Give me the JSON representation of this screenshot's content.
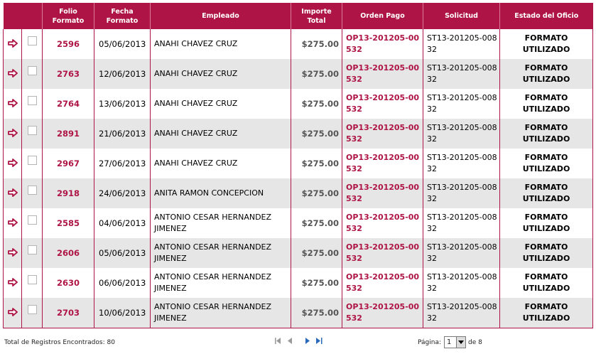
{
  "headers": {
    "folio": "Folio Formato",
    "fecha": "Fecha Formato",
    "empleado": "Empleado",
    "importe": "Importe Total",
    "orden": "Orden Pago",
    "solicitud": "Solicitud",
    "estado": "Estado del Oficio"
  },
  "rows": [
    {
      "folio": "2596",
      "fecha": "05/06/2013",
      "empleado": "ANAHI CHAVEZ CRUZ",
      "importe": "$275.00",
      "orden": "OP13-201205-00532",
      "solicitud": "ST13-201205-00832",
      "estado": "FORMATO UTILIZADO"
    },
    {
      "folio": "2763",
      "fecha": "12/06/2013",
      "empleado": "ANAHI CHAVEZ CRUZ",
      "importe": "$275.00",
      "orden": "OP13-201205-00532",
      "solicitud": "ST13-201205-00832",
      "estado": "FORMATO UTILIZADO"
    },
    {
      "folio": "2764",
      "fecha": "13/06/2013",
      "empleado": "ANAHI CHAVEZ CRUZ",
      "importe": "$275.00",
      "orden": "OP13-201205-00532",
      "solicitud": "ST13-201205-00832",
      "estado": "FORMATO UTILIZADO"
    },
    {
      "folio": "2891",
      "fecha": "21/06/2013",
      "empleado": "ANAHI CHAVEZ CRUZ",
      "importe": "$275.00",
      "orden": "OP13-201205-00532",
      "solicitud": "ST13-201205-00832",
      "estado": "FORMATO UTILIZADO"
    },
    {
      "folio": "2967",
      "fecha": "27/06/2013",
      "empleado": "ANAHI CHAVEZ CRUZ",
      "importe": "$275.00",
      "orden": "OP13-201205-00532",
      "solicitud": "ST13-201205-00832",
      "estado": "FORMATO UTILIZADO"
    },
    {
      "folio": "2918",
      "fecha": "24/06/2013",
      "empleado": "ANITA RAMON CONCEPCION",
      "importe": "$275.00",
      "orden": "OP13-201205-00532",
      "solicitud": "ST13-201205-00832",
      "estado": "FORMATO UTILIZADO"
    },
    {
      "folio": "2585",
      "fecha": "04/06/2013",
      "empleado": "ANTONIO CESAR HERNANDEZ JIMENEZ",
      "importe": "$275.00",
      "orden": "OP13-201205-00532",
      "solicitud": "ST13-201205-00832",
      "estado": "FORMATO UTILIZADO"
    },
    {
      "folio": "2606",
      "fecha": "05/06/2013",
      "empleado": "ANTONIO CESAR HERNANDEZ JIMENEZ",
      "importe": "$275.00",
      "orden": "OP13-201205-00532",
      "solicitud": "ST13-201205-00832",
      "estado": "FORMATO UTILIZADO"
    },
    {
      "folio": "2630",
      "fecha": "06/06/2013",
      "empleado": "ANTONIO CESAR HERNANDEZ JIMENEZ",
      "importe": "$275.00",
      "orden": "OP13-201205-00532",
      "solicitud": "ST13-201205-00832",
      "estado": "FORMATO UTILIZADO"
    },
    {
      "folio": "2703",
      "fecha": "10/06/2013",
      "empleado": "ANTONIO CESAR HERNANDEZ JIMENEZ",
      "importe": "$275.00",
      "orden": "OP13-201205-00532",
      "solicitud": "ST13-201205-00832",
      "estado": "FORMATO UTILIZADO"
    }
  ],
  "footer": {
    "total_label": "Total de Registros Encontrados: 80",
    "page_label": "Página:",
    "current_page": "1",
    "of_label": "de 8"
  },
  "icons": {
    "row_action": "arrow-right-icon",
    "first": "first-page-icon",
    "prev": "prev-page-icon",
    "next": "next-page-icon",
    "last": "last-page-icon"
  },
  "colors": {
    "header_bg": "#ae1546",
    "link": "#ae1546",
    "row_alt": "#e6e6e6",
    "pager_active": "#2a6ab8"
  }
}
